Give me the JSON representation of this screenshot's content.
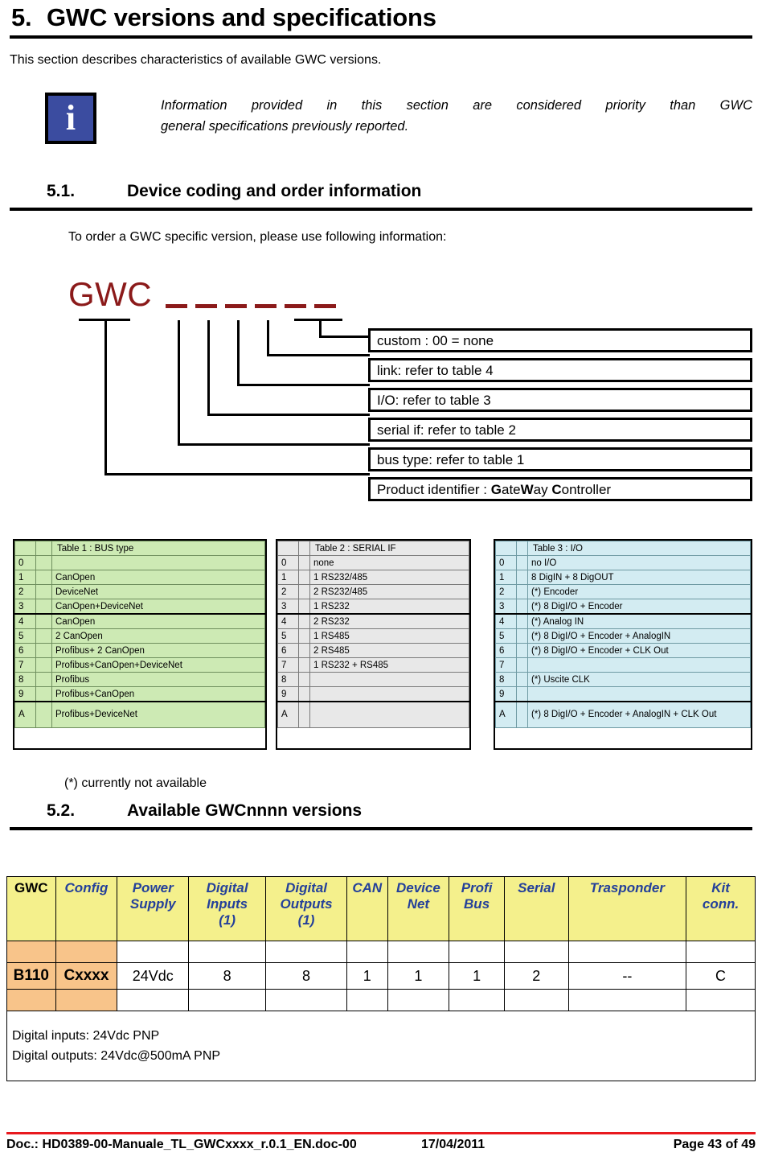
{
  "section": {
    "number": "5.",
    "title": "GWC versions and specifications",
    "intro": "This section describes characteristics of available GWC versions.",
    "note_line1": "Information provided in this section are considered priority than GWC",
    "note_line2": "general specifications previously reported.",
    "note_icon": "info-icon"
  },
  "sub1": {
    "number": "5.1.",
    "title": "Device coding and order information",
    "intro": "To order a GWC specific version, please use following information:"
  },
  "diagram": {
    "code_word": "GWC",
    "callouts": [
      {
        "text": "custom : 00 = none"
      },
      {
        "text": "link: refer to table 4"
      },
      {
        "text": "I/O: refer to table 3"
      },
      {
        "text": "serial if: refer to table 2"
      },
      {
        "text": "bus type: refer to table 1"
      },
      {
        "text_prefix": "Product identifier : ",
        "g": "G",
        "ate": "ate",
        "w": "W",
        "ay": "ay ",
        "c": "C",
        "ontroller": "ontroller"
      }
    ]
  },
  "table1": {
    "title": "Table 1 : BUS type",
    "rows": [
      {
        "idx": "0",
        "val": ""
      },
      {
        "idx": "1",
        "val": "CanOpen"
      },
      {
        "idx": "2",
        "val": "DeviceNet"
      },
      {
        "idx": "3",
        "val": "CanOpen+DeviceNet"
      },
      {
        "idx": "4",
        "val": "CanOpen"
      },
      {
        "idx": "5",
        "val": "2 CanOpen"
      },
      {
        "idx": "6",
        "val": "Profibus+ 2 CanOpen"
      },
      {
        "idx": "7",
        "val": "Profibus+CanOpen+DeviceNet"
      },
      {
        "idx": "8",
        "val": "Profibus"
      },
      {
        "idx": "9",
        "val": "Profibus+CanOpen"
      },
      {
        "idx": "A",
        "val": "Profibus+DeviceNet"
      }
    ]
  },
  "table2": {
    "title": "Table 2 : SERIAL IF",
    "rows": [
      {
        "idx": "0",
        "val": "none"
      },
      {
        "idx": "1",
        "val": "1 RS232/485"
      },
      {
        "idx": "2",
        "val": "2 RS232/485"
      },
      {
        "idx": "3",
        "val": "1 RS232"
      },
      {
        "idx": "4",
        "val": "2 RS232"
      },
      {
        "idx": "5",
        "val": "1 RS485"
      },
      {
        "idx": "6",
        "val": "2 RS485"
      },
      {
        "idx": "7",
        "val": "1 RS232 + RS485"
      },
      {
        "idx": "8",
        "val": ""
      },
      {
        "idx": "9",
        "val": ""
      },
      {
        "idx": "A",
        "val": ""
      }
    ]
  },
  "table3": {
    "title": "Table 3 : I/O",
    "rows": [
      {
        "idx": "0",
        "val": "no I/O"
      },
      {
        "idx": "1",
        "val": "8 DigIN + 8 DigOUT"
      },
      {
        "idx": "2",
        "val": "(*) Encoder"
      },
      {
        "idx": "3",
        "val": "(*) 8 DigI/O + Encoder"
      },
      {
        "idx": "4",
        "val": "(*) Analog IN"
      },
      {
        "idx": "5",
        "val": "(*) 8 DigI/O + Encoder + AnalogIN"
      },
      {
        "idx": "6",
        "val": "(*) 8 DigI/O + Encoder + CLK Out"
      },
      {
        "idx": "7",
        "val": ""
      },
      {
        "idx": "8",
        "val": "(*) Uscite CLK"
      },
      {
        "idx": "9",
        "val": ""
      },
      {
        "idx": "A",
        "val": "(*) 8 DigI/O + Encoder + AnalogIN + CLK Out"
      }
    ]
  },
  "footnote_star": "(*) currently not available",
  "sub2": {
    "number": "5.2.",
    "title": "Available GWCnnnn versions"
  },
  "versions_table": {
    "headers": [
      "GWC",
      "Config",
      "Power Supply",
      "Digital Inputs (1)",
      "Digital Outputs (1)",
      "CAN",
      "Device Net",
      "Profi Bus",
      "Serial",
      "Trasponder",
      "Kit conn."
    ],
    "row": [
      "B110",
      "Cxxxx",
      "24Vdc",
      "8",
      "8",
      "1",
      "1",
      "1",
      "2",
      "--",
      "C"
    ],
    "notes_line1": "Digital inputs: 24Vdc PNP",
    "notes_line2": "Digital outputs: 24Vdc@500mA PNP"
  },
  "footer": {
    "doc": "Doc.: HD0389-00-Manuale_TL_GWCxxxx_r.0.1_EN.doc-00",
    "date": "17/04/2011",
    "page": "Page 43 of 49"
  },
  "colors": {
    "accent_red": "#8b1a1a",
    "info_blue": "#3b4ca0",
    "table1_bg": "#cdeab4",
    "table2_bg": "#e8e8e8",
    "table3_bg": "#d3ecf2",
    "header_yellow": "#f4f08c",
    "header_blue_text": "#24409a",
    "orange_cell": "#f8c48a",
    "footer_rule": "#e8191e"
  }
}
